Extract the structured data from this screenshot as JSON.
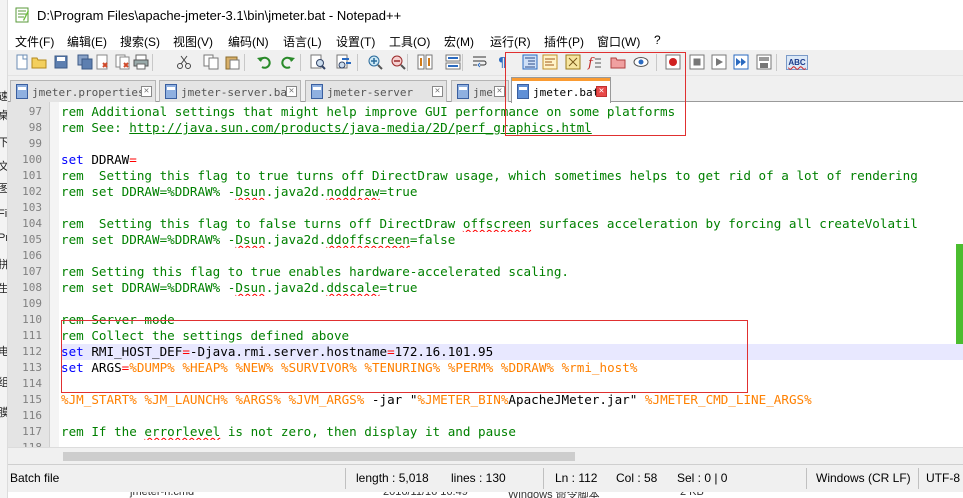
{
  "window": {
    "title": "D:\\Program Files\\apache-jmeter-3.1\\bin\\jmeter.bat - Notepad++"
  },
  "menu": [
    {
      "label": "文件(F)"
    },
    {
      "label": "编辑(E)"
    },
    {
      "label": "搜索(S)"
    },
    {
      "label": "视图(V)"
    },
    {
      "label": "编码(N)"
    },
    {
      "label": "语言(L)"
    },
    {
      "label": "设置(T)"
    },
    {
      "label": "工具(O)"
    },
    {
      "label": "宏(M)"
    },
    {
      "label": "运行(R)"
    },
    {
      "label": "插件(P)"
    },
    {
      "label": "窗口(W)"
    },
    {
      "label": "?"
    }
  ],
  "toolbar": {
    "icons": [
      "new-file-icon",
      "open-file-icon",
      "save-icon",
      "save-all-icon",
      "close-icon",
      "close-all-icon",
      "print-icon",
      "cut-icon",
      "copy-icon",
      "paste-icon",
      "undo-icon",
      "redo-icon",
      "find-icon",
      "replace-icon",
      "zoom-in-icon",
      "zoom-out-icon",
      "sync-vertical-icon",
      "sync-horizontal-icon",
      "word-wrap-icon",
      "show-all-chars-icon",
      "indent-guide-icon",
      "user-language-icon",
      "doc-map-icon",
      "function-list-icon",
      "folder-as-workspace-icon",
      "monitor-icon",
      "record-macro-icon",
      "stop-macro-icon",
      "play-macro-icon",
      "run-macro-multiple-icon",
      "save-macro-icon",
      "spellcheck-icon"
    ],
    "spellcheck_label": "ABC"
  },
  "tabs": [
    {
      "label": "jmeter.properties",
      "active": false
    },
    {
      "label": "jmeter-server.bat",
      "active": false
    },
    {
      "label": "jmeter-server",
      "active": false
    },
    {
      "label": "jmeter.log",
      "active": false
    },
    {
      "label": "jmeter.bat",
      "active": true
    }
  ],
  "editor": {
    "current_line": 112,
    "lines": [
      {
        "n": "97",
        "parts": [
          [
            "c",
            "rem Additional settings that might help improve GUI performance on some platforms"
          ]
        ]
      },
      {
        "n": "98",
        "parts": [
          [
            "c",
            "rem See: "
          ],
          [
            "cu",
            "http://java.sun.com/products/java-media/2D/perf_graphics.html"
          ]
        ]
      },
      {
        "n": "99",
        "parts": []
      },
      {
        "n": "100",
        "parts": [
          [
            "k",
            "set"
          ],
          [
            "b",
            " DDRAW"
          ],
          [
            "o",
            "="
          ]
        ]
      },
      {
        "n": "101",
        "parts": [
          [
            "c",
            "rem  Setting this flag to true turns off DirectDraw usage, which sometimes helps to get rid of a lot of rendering"
          ]
        ]
      },
      {
        "n": "102",
        "parts": [
          [
            "c",
            "rem set DDRAW=%DDRAW% -"
          ],
          [
            "cs",
            "Dsun"
          ],
          [
            "c",
            ".java2d."
          ],
          [
            "cs",
            "noddraw"
          ],
          [
            "c",
            "=true"
          ]
        ]
      },
      {
        "n": "103",
        "parts": []
      },
      {
        "n": "104",
        "parts": [
          [
            "c",
            "rem  Setting this flag to false turns off DirectDraw "
          ],
          [
            "cs",
            "offscreen"
          ],
          [
            "c",
            " surfaces acceleration by forcing all createVolatil"
          ]
        ]
      },
      {
        "n": "105",
        "parts": [
          [
            "c",
            "rem set DDRAW=%DDRAW% -"
          ],
          [
            "cs",
            "Dsun"
          ],
          [
            "c",
            ".java2d."
          ],
          [
            "cs",
            "ddoffscreen"
          ],
          [
            "c",
            "=false"
          ]
        ]
      },
      {
        "n": "106",
        "parts": []
      },
      {
        "n": "107",
        "parts": [
          [
            "c",
            "rem Setting this flag to true enables hardware-accelerated scaling."
          ]
        ]
      },
      {
        "n": "108",
        "parts": [
          [
            "c",
            "rem set DDRAW=%DDRAW% -"
          ],
          [
            "cs",
            "Dsun"
          ],
          [
            "c",
            ".java2d."
          ],
          [
            "cs",
            "ddscale"
          ],
          [
            "c",
            "=true"
          ]
        ]
      },
      {
        "n": "109",
        "parts": []
      },
      {
        "n": "110",
        "parts": [
          [
            "c",
            "rem Server mode"
          ]
        ]
      },
      {
        "n": "111",
        "parts": [
          [
            "c",
            "rem Collect the settings defined above"
          ]
        ]
      },
      {
        "n": "112",
        "parts": [
          [
            "k",
            "set"
          ],
          [
            "b",
            " RMI_HOST_DEF"
          ],
          [
            "o",
            "="
          ],
          [
            "b",
            "-Djava.rmi.server.hostname"
          ],
          [
            "o",
            "="
          ],
          [
            "b",
            "172.16.101.95"
          ]
        ]
      },
      {
        "n": "113",
        "parts": [
          [
            "k",
            "set"
          ],
          [
            "b",
            " ARGS"
          ],
          [
            "o",
            "="
          ],
          [
            "v",
            "%DUMP%"
          ],
          [
            "b",
            " "
          ],
          [
            "v",
            "%HEAP%"
          ],
          [
            "b",
            " "
          ],
          [
            "v",
            "%NEW%"
          ],
          [
            "b",
            " "
          ],
          [
            "v",
            "%SURVIVOR%"
          ],
          [
            "b",
            " "
          ],
          [
            "v",
            "%TENURING%"
          ],
          [
            "b",
            " "
          ],
          [
            "v",
            "%PERM%"
          ],
          [
            "b",
            " "
          ],
          [
            "v",
            "%DDRAW%"
          ],
          [
            "b",
            " "
          ],
          [
            "v",
            "%rmi_host%"
          ]
        ]
      },
      {
        "n": "114",
        "parts": []
      },
      {
        "n": "115",
        "parts": [
          [
            "v",
            "%JM_START%"
          ],
          [
            "b",
            " "
          ],
          [
            "v",
            "%JM_LAUNCH%"
          ],
          [
            "b",
            " "
          ],
          [
            "v",
            "%ARGS%"
          ],
          [
            "b",
            " "
          ],
          [
            "v",
            "%JVM_ARGS%"
          ],
          [
            "b",
            " -jar \""
          ],
          [
            "v",
            "%JMETER_BIN%"
          ],
          [
            "b",
            "ApacheJMeter.jar\" "
          ],
          [
            "v",
            "%JMETER_CMD_LINE_ARGS%"
          ]
        ]
      },
      {
        "n": "116",
        "parts": []
      },
      {
        "n": "117",
        "parts": [
          [
            "c",
            "rem If the "
          ],
          [
            "cs",
            "errorlevel"
          ],
          [
            "c",
            " is not zero, then display it and pause"
          ]
        ]
      },
      {
        "n": "118",
        "parts": []
      }
    ]
  },
  "status": {
    "file_type": "Batch file",
    "length": "length : 5,018",
    "lines": "lines : 130",
    "ln": "Ln : 112",
    "col": "Col : 58",
    "sel": "Sel : 0 | 0",
    "eol": "Windows (CR LF)",
    "encoding": "UTF-8"
  },
  "background_window": {
    "left_chars": [
      "速",
      "桌",
      "下",
      "文",
      "图",
      "Fil",
      "Pr",
      "拼",
      "生",
      "电",
      "组",
      "膜"
    ],
    "behind_row": [
      "jmeter-n.cmd",
      "2016/11/16 16:49",
      "Windows 命令脚本",
      "2 KB"
    ]
  },
  "colors": {
    "comment": "#008000",
    "keyword": "#0000ff",
    "operator": "#ff0000",
    "variable": "#ff8000",
    "active_tab_accent": "#fa9b32",
    "current_line": "#e8e8ff",
    "highlight_box": "#e03030"
  }
}
